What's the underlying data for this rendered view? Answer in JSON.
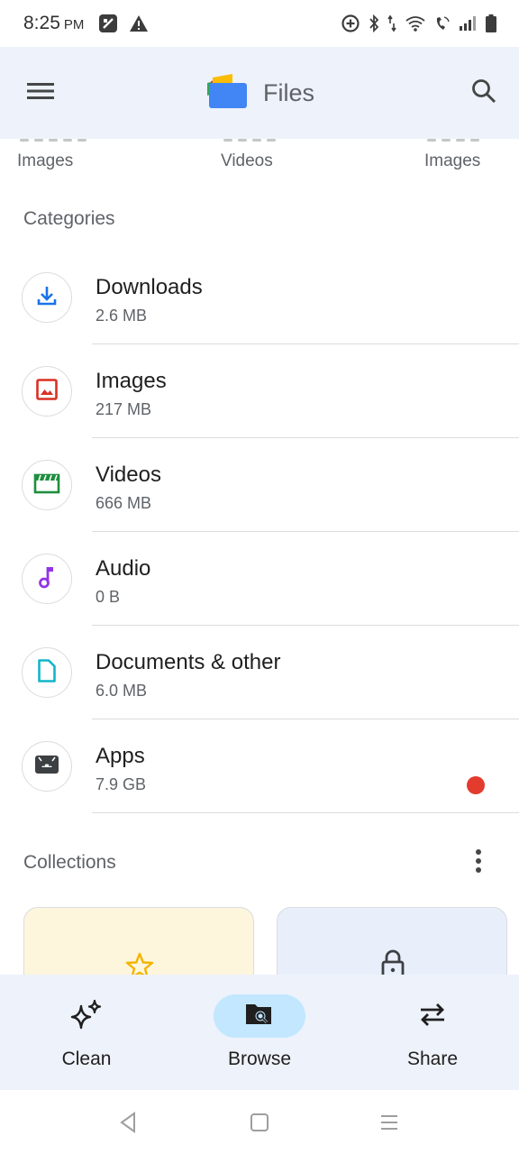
{
  "status_bar": {
    "time": "8:25",
    "ampm": "PM",
    "icons": [
      "sim-card-icon",
      "warning-icon",
      "data-saver-icon",
      "bluetooth-icon",
      "data-arrows-icon",
      "wifi-icon",
      "wifi-calling-icon",
      "signal-icon",
      "battery-icon"
    ]
  },
  "app_bar": {
    "title": "Files",
    "menu_icon": "hamburger-menu-icon",
    "logo_icon": "files-logo-icon",
    "search_icon": "search-icon"
  },
  "recent_labels": [
    "Images",
    "Videos",
    "Images"
  ],
  "categories_title": "Categories",
  "categories": [
    {
      "name": "Downloads",
      "size": "2.6 MB",
      "icon": "download-icon",
      "color": "#1a73e8"
    },
    {
      "name": "Images",
      "size": "217 MB",
      "icon": "image-icon",
      "color": "#d93025"
    },
    {
      "name": "Videos",
      "size": "666 MB",
      "icon": "video-icon",
      "color": "#1e8e3e"
    },
    {
      "name": "Audio",
      "size": "0 B",
      "icon": "music-note-icon",
      "color": "#9334e6"
    },
    {
      "name": "Documents & other",
      "size": "6.0 MB",
      "icon": "document-icon",
      "color": "#12b5cb"
    },
    {
      "name": "Apps",
      "size": "7.9 GB",
      "icon": "android-app-icon",
      "color": "#3c4043",
      "badge": true
    }
  ],
  "collections_title": "Collections",
  "collections": [
    {
      "icon": "star-icon",
      "color": "#f4b400"
    },
    {
      "icon": "lock-icon",
      "color": "#3c4043"
    }
  ],
  "bottom_nav": [
    {
      "label": "Clean",
      "icon": "sparkle-icon",
      "active": false
    },
    {
      "label": "Browse",
      "icon": "folder-search-icon",
      "active": true
    },
    {
      "label": "Share",
      "icon": "swap-arrows-icon",
      "active": false
    }
  ],
  "system_nav": [
    "back-icon",
    "home-icon",
    "recents-icon"
  ],
  "colors": {
    "app_bar_bg": "#eef2fb",
    "active_pill": "#c2e7ff",
    "badge": "#e33b2e",
    "divider": "#dadce0"
  }
}
